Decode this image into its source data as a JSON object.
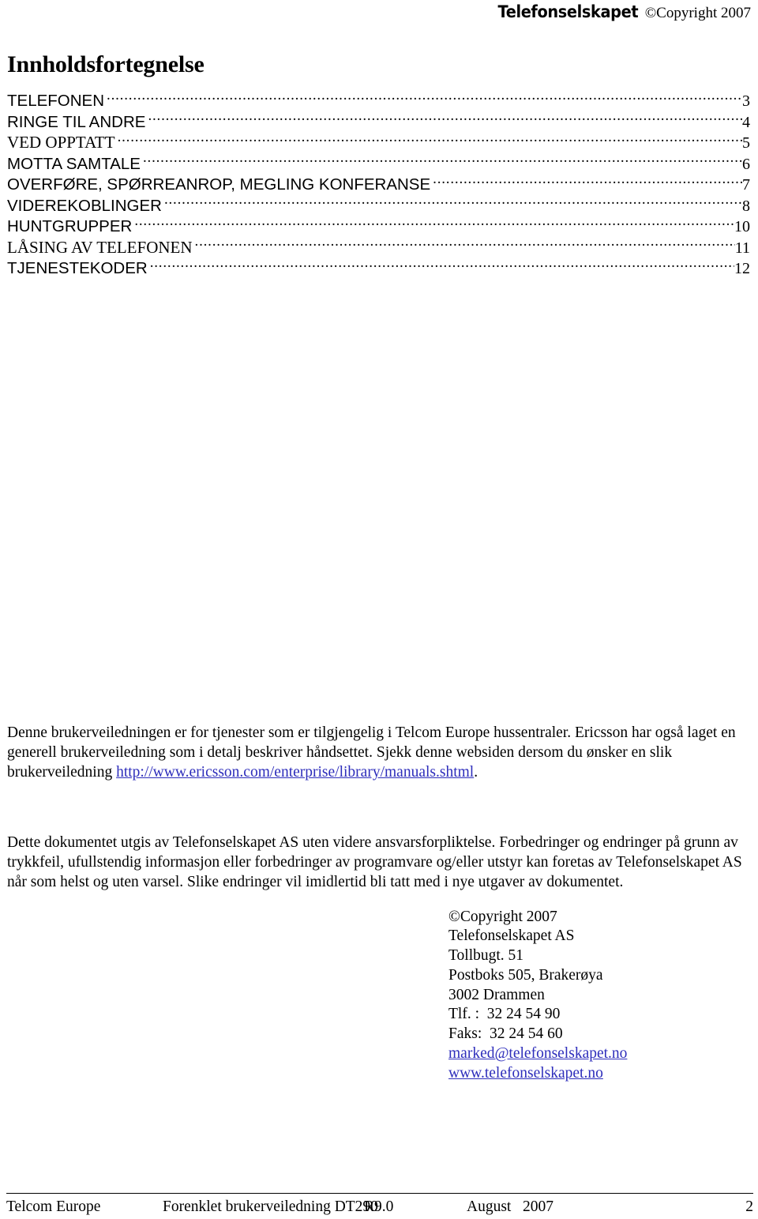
{
  "header": {
    "brand": "Telefonselskapet",
    "copyright": "©Copyright 2007"
  },
  "toc": {
    "heading": "Innholdsfortegnelse",
    "entries": [
      {
        "label": "TELEFONEN",
        "page": "3",
        "style": "sans"
      },
      {
        "label": "RINGE TIL ANDRE",
        "page": "4",
        "style": "sans"
      },
      {
        "label": "VED OPPTATT",
        "page": "5",
        "style": "condensed"
      },
      {
        "label": "MOTTA SAMTALE",
        "page": "6",
        "style": "sans"
      },
      {
        "label": "OVERFØRE, SPØRREANROP, MEGLING KONFERANSE",
        "page": "7",
        "style": "sans"
      },
      {
        "label": "VIDEREKOBLINGER",
        "page": "8",
        "style": "sans"
      },
      {
        "label": "HUNTGRUPPER",
        "page": "10",
        "style": "sans"
      },
      {
        "label": "LÅSING AV TELEFONEN",
        "page": "11",
        "style": "condensed"
      },
      {
        "label": "TJENESTEKODER",
        "page": "12",
        "style": "sans"
      }
    ]
  },
  "intro": {
    "text_before_link": "Denne brukerveiledningen er for tjenester som er tilgjengelig i Telcom Europe hussentraler.  Ericsson har også laget en generell brukerveiledning som i detalj beskriver håndsettet. Sjekk denne websiden dersom du ønsker en slik brukerveiledning ",
    "link_text": "http://www.ericsson.com/enterprise/library/manuals.shtml",
    "text_after_link": "."
  },
  "disclaimer": {
    "text": "Dette dokumentet utgis av Telefonselskapet AS uten videre ansvarsforpliktelse.  Forbedringer og endringer på grunn av trykkfeil, ufullstendig informasjon eller forbedringer av programvare og/eller utstyr kan foretas av Telefonselskapet AS når som helst og uten varsel.  Slike endringer vil imidlertid bli tatt med i nye utgaver av dokumentet."
  },
  "address": {
    "copyright": "©Copyright 2007",
    "company": "Telefonselskapet AS",
    "street": "Tollbugt. 51",
    "postbox": "Postboks 505, Brakerøya",
    "city": "3002 Drammen",
    "phone": "Tlf. :  32 24 54 90",
    "fax": "Faks:  32 24 54 60",
    "email": "marked@telefonselskapet.no",
    "website": "www.telefonselskapet.no"
  },
  "footer": {
    "company": "Telcom Europe",
    "title": "Forenklet brukerveiledning DT290",
    "revision": "R9.0",
    "date": "August   2007",
    "page": "2"
  },
  "colors": {
    "text": "#000000",
    "link": "#2d2dbb",
    "background": "#ffffff"
  }
}
